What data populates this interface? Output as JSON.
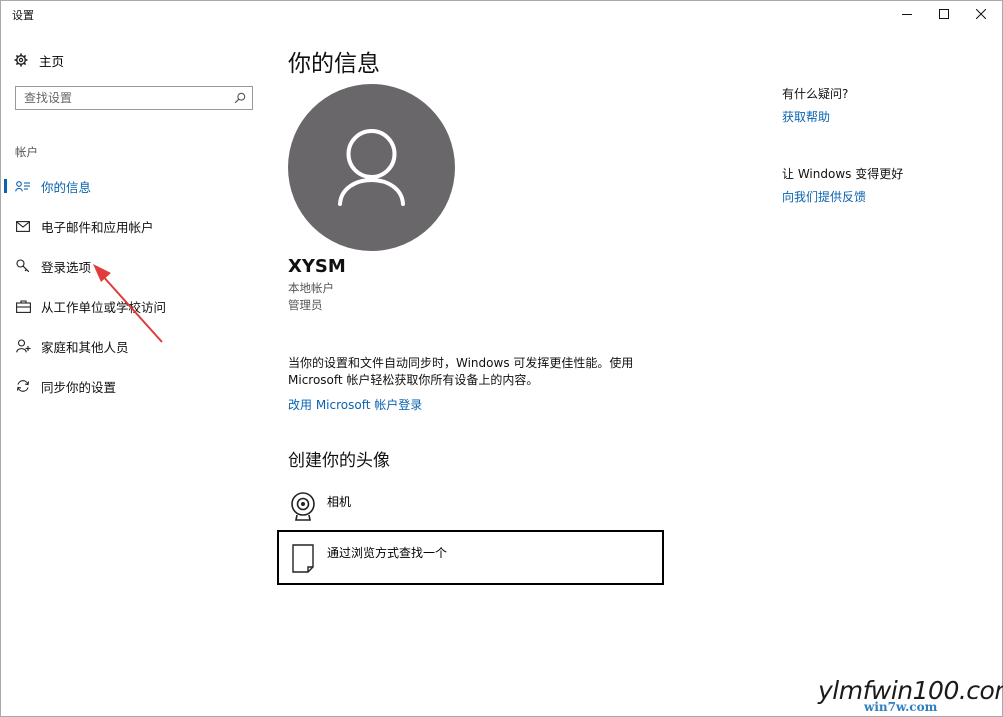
{
  "window": {
    "title": "设置"
  },
  "sidebar": {
    "home_label": "主页",
    "search_placeholder": "查找设置",
    "section_header": "帐户",
    "items": [
      {
        "label": "你的信息",
        "icon": "person-card-icon",
        "active": true
      },
      {
        "label": "电子邮件和应用帐户",
        "icon": "mail-icon",
        "active": false
      },
      {
        "label": "登录选项",
        "icon": "key-icon",
        "active": false
      },
      {
        "label": "从工作单位或学校访问",
        "icon": "briefcase-icon",
        "active": false
      },
      {
        "label": "家庭和其他人员",
        "icon": "person-add-icon",
        "active": false
      },
      {
        "label": "同步你的设置",
        "icon": "sync-icon",
        "active": false
      }
    ]
  },
  "main": {
    "title": "你的信息",
    "user": {
      "name": "XYSM",
      "account_type": "本地帐户",
      "role": "管理员"
    },
    "sync_text": "当你的设置和文件自动同步时，Windows 可发挥更佳性能。使用 Microsoft 帐户轻松获取你所有设备上的内容。",
    "ms_link": "改用 Microsoft 帐户登录",
    "create_avatar_title": "创建你的头像",
    "camera_label": "相机",
    "browse_label": "通过浏览方式查找一个"
  },
  "right": {
    "help_question": "有什么疑问?",
    "help_link": "获取帮助",
    "improve_title": "让 Windows 变得更好",
    "feedback_link": "向我们提供反馈"
  },
  "watermark": {
    "main": "ylmfwin100.com",
    "sub": "win7w.com"
  },
  "colors": {
    "accent": "#0a63b0",
    "avatar": "#696769",
    "arrow": "#e03c3c"
  }
}
